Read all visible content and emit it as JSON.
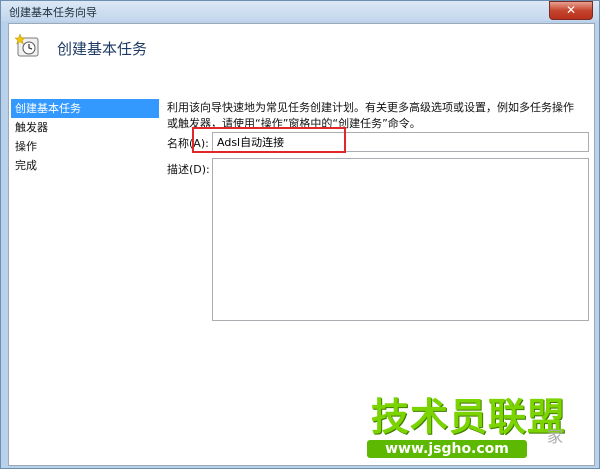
{
  "window": {
    "title": "创建基本任务向导",
    "close_glyph": "✕"
  },
  "header": {
    "title": "创建基本任务"
  },
  "nav": {
    "items": [
      {
        "label": "创建基本任务",
        "active": true
      },
      {
        "label": "触发器"
      },
      {
        "label": "操作"
      },
      {
        "label": "完成"
      }
    ]
  },
  "main": {
    "description": "利用该向导快速地为常见任务创建计划。有关更多高级选项或设置，例如多任务操作或触发器，请使用“操作”窗格中的“创建任务”命令。",
    "name_label": "名称(A):",
    "name_value": "Adsl自动连接",
    "desc_label": "描述(D):",
    "desc_value": ""
  },
  "watermark": {
    "text": "技术员联盟",
    "url": "www.jsgho.com",
    "side": "家"
  },
  "colors": {
    "selection": "#3399ff",
    "highlight_box": "#e0282c",
    "watermark": "#7bd300"
  }
}
